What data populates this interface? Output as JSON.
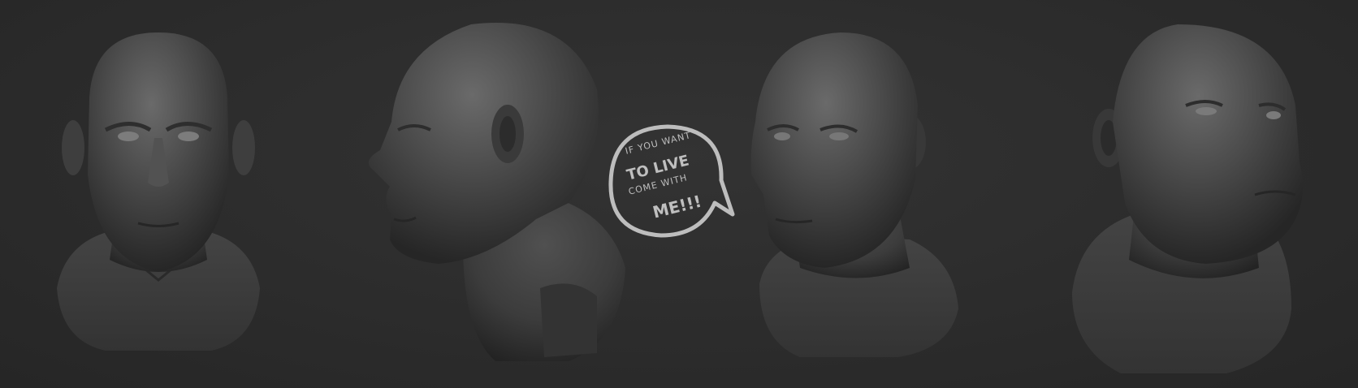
{
  "scene": {
    "background_color": "#2b2b2b",
    "clay_color": "#4a4a4a",
    "clay_highlight": "#6e6e6e",
    "clay_shadow": "#242424"
  },
  "speech_bubble": {
    "line1": "IF YOU WANT",
    "line2": "TO LIVE",
    "line3": "COME WITH",
    "line4": "ME!!!",
    "color": "#bdbdbd"
  }
}
